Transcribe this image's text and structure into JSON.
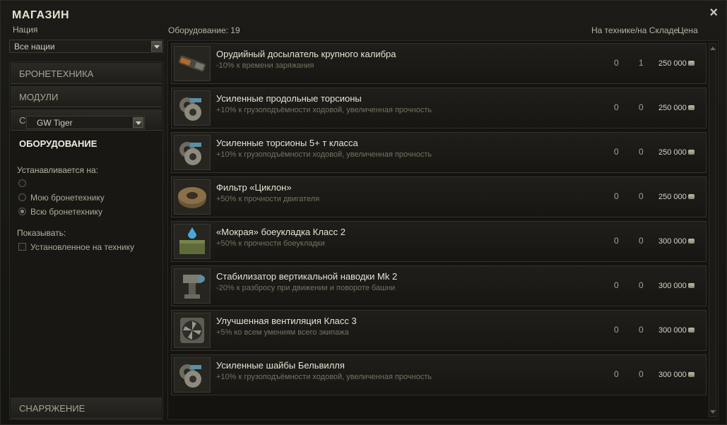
{
  "window": {
    "title": "МАГАЗИН",
    "close_icon": "×"
  },
  "nation": {
    "label": "Нация",
    "selected": "Все нации"
  },
  "header": {
    "count_label": "Оборудование: 19",
    "col_vehicle_stock": "На технике/на Складе",
    "col_price": "Цена"
  },
  "sidebar": {
    "categories": [
      {
        "label": "БРОНЕТЕХНИКА",
        "active": false
      },
      {
        "label": "МОДУЛИ",
        "active": false
      },
      {
        "label": "СНАРЯДЫ",
        "active": false
      },
      {
        "label": "ОБОРУДОВАНИЕ",
        "active": true
      }
    ],
    "install_on_label": "Устанавливается на:",
    "tank_selected": "GW Tiger",
    "radio_my": "Мою бронетехнику",
    "radio_all": "Всю бронетехнику",
    "show_label": "Показывать:",
    "checkbox_installed": "Установленное на технику",
    "bottom_category": "СНАРЯЖЕНИЕ"
  },
  "items": [
    {
      "icon": "rammer-icon",
      "name": "Орудийный досылатель крупного калибра",
      "desc": "-10% к времени заряжания",
      "on_vehicle": "0",
      "in_stock": "1",
      "price": "250 000"
    },
    {
      "icon": "torsion-bars-icon",
      "name": "Усиленные продольные торсионы",
      "desc": "+10% к грузоподъёмности ходовой, увеличенная прочность",
      "on_vehicle": "0",
      "in_stock": "0",
      "price": "250 000"
    },
    {
      "icon": "torsion-bars-icon",
      "name": "Усиленные торсионы 5+ т класса",
      "desc": "+10% к грузоподъёмности ходовой, увеличенная прочность",
      "on_vehicle": "0",
      "in_stock": "0",
      "price": "250 000"
    },
    {
      "icon": "cyclone-filter-icon",
      "name": "Фильтр «Циклон»",
      "desc": "+50% к прочности двигателя",
      "on_vehicle": "0",
      "in_stock": "0",
      "price": "250 000"
    },
    {
      "icon": "wet-ammo-rack-icon",
      "name": "«Мокрая» боеукладка Класс 2",
      "desc": "+50% к прочности боеукладки",
      "on_vehicle": "0",
      "in_stock": "0",
      "price": "300 000"
    },
    {
      "icon": "stabilizer-icon",
      "name": "Стабилизатор вертикальной наводки Mk 2",
      "desc": "-20% к разбросу при движении и повороте башни",
      "on_vehicle": "0",
      "in_stock": "0",
      "price": "300 000"
    },
    {
      "icon": "ventilation-icon",
      "name": "Улучшенная вентиляция Класс 3",
      "desc": "+5% ко всем умениям всего экипажа",
      "on_vehicle": "0",
      "in_stock": "0",
      "price": "300 000"
    },
    {
      "icon": "belleville-springs-icon",
      "name": "Усиленные шайбы Бельвилля",
      "desc": "+10% к грузоподъёмности ходовой, увеличенная прочность",
      "on_vehicle": "0",
      "in_stock": "0",
      "price": "300 000"
    }
  ]
}
